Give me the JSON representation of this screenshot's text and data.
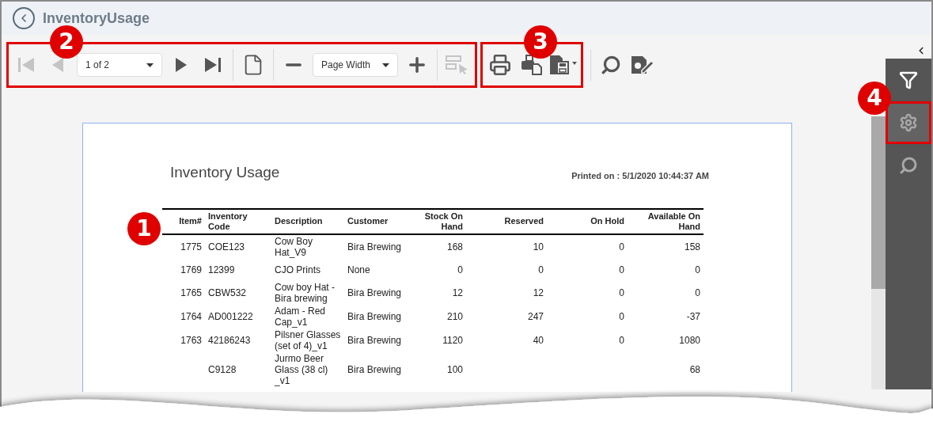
{
  "window": {
    "title": "InventoryUsage"
  },
  "toolbar": {
    "groups": [
      {
        "callout": "2",
        "items": [
          {
            "kind": "first",
            "disabled": true
          },
          {
            "kind": "prev",
            "disabled": true
          },
          {
            "kind": "dropdown",
            "value": "1 of 2"
          },
          {
            "kind": "next",
            "disabled": false
          },
          {
            "kind": "last",
            "disabled": false
          },
          {
            "kind": "separator"
          },
          {
            "kind": "page",
            "disabled": false
          },
          {
            "kind": "separator"
          },
          {
            "kind": "zoom_out",
            "disabled": false
          },
          {
            "kind": "dropdown",
            "value": "Page Width"
          },
          {
            "kind": "zoom_in",
            "disabled": false
          },
          {
            "kind": "separator"
          },
          {
            "kind": "select",
            "disabled": true
          }
        ]
      },
      {
        "callout": "3",
        "items": [
          {
            "kind": "print",
            "disabled": false
          },
          {
            "kind": "print_layout",
            "disabled": false
          },
          {
            "kind": "export",
            "disabled": false
          }
        ]
      },
      {
        "items": [
          {
            "kind": "separator"
          },
          {
            "kind": "search",
            "disabled": false
          },
          {
            "kind": "parameters",
            "disabled": false
          }
        ]
      }
    ]
  },
  "side_panel": {
    "items": [
      {
        "kind": "filter"
      },
      {
        "kind": "settings",
        "callout": "4"
      },
      {
        "kind": "search"
      }
    ]
  },
  "report": {
    "title": "Inventory Usage",
    "printed_on": "Printed on : 5/1/2020 10:44:37 AM",
    "callout": "1",
    "columns": [
      {
        "label": "Item#",
        "kind": "number"
      },
      {
        "label": "Inventory Code",
        "kind": "text"
      },
      {
        "label": "Description",
        "kind": "text"
      },
      {
        "label": "Customer",
        "kind": "text"
      },
      {
        "label": "Stock On Hand",
        "kind": "number"
      },
      {
        "label": "Reserved",
        "kind": "number"
      },
      {
        "label": "On Hold",
        "kind": "number"
      },
      {
        "label": "Available On Hand",
        "kind": "number"
      }
    ],
    "rows": [
      {
        "cells": [
          "1775",
          "COE123",
          "Cow Boy Hat_V9",
          "Bira Brewing",
          "168",
          "10",
          "0",
          "158"
        ]
      },
      {
        "cells": [
          "1769",
          "12399",
          "CJO Prints",
          "None",
          "0",
          "0",
          "0",
          "0"
        ]
      },
      {
        "cells": [
          "1765",
          "CBW532",
          "Cow boy Hat - Bira brewing",
          "Bira Brewing",
          "12",
          "12",
          "0",
          "0"
        ]
      },
      {
        "cells": [
          "1764",
          "AD001222",
          "Adam - Red Cap_v1",
          "Bira Brewing",
          "210",
          "247",
          "0",
          "-37"
        ]
      },
      {
        "cells": [
          "1763",
          "42186243",
          "Pilsner Glasses (set of 4)_v1",
          "Bira Brewing",
          "1120",
          "40",
          "0",
          "1080"
        ]
      },
      {
        "cells": [
          null,
          "C9128",
          "Jurmo Beer Glass (38 cl) _v1",
          "Bira Brewing",
          "100",
          null,
          null,
          "68"
        ]
      }
    ]
  }
}
